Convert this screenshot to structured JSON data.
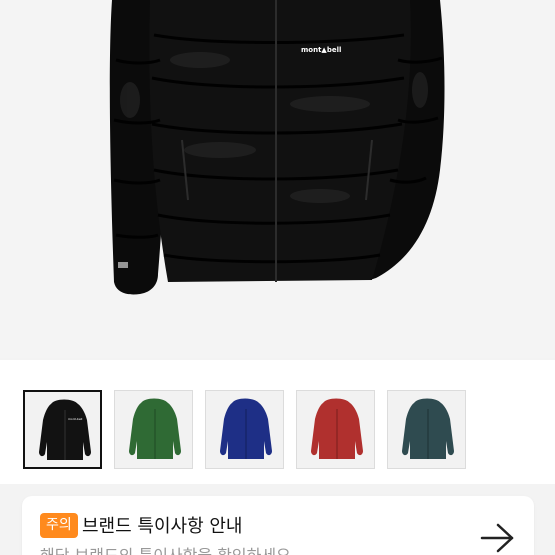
{
  "hero": {
    "logo_text": "mont▲bell",
    "colorway": "black"
  },
  "thumbnails": [
    {
      "color_name": "black",
      "color": "#121212",
      "selected": true
    },
    {
      "color_name": "green",
      "color": "#2f6a34",
      "selected": false
    },
    {
      "color_name": "navy",
      "color": "#1e2f86",
      "selected": false
    },
    {
      "color_name": "red",
      "color": "#b0302e",
      "selected": false
    },
    {
      "color_name": "teal",
      "color": "#2f4b50",
      "selected": false
    }
  ],
  "notice": {
    "badge": "주의",
    "title": "브랜드 특이사항 안내",
    "subtitle": "해당 브랜드의 특이사항을 확인하세요",
    "arrow_icon": "arrow-right-icon"
  },
  "colors": {
    "accent": "#ff8a1d",
    "background": "#f3f3f3"
  }
}
